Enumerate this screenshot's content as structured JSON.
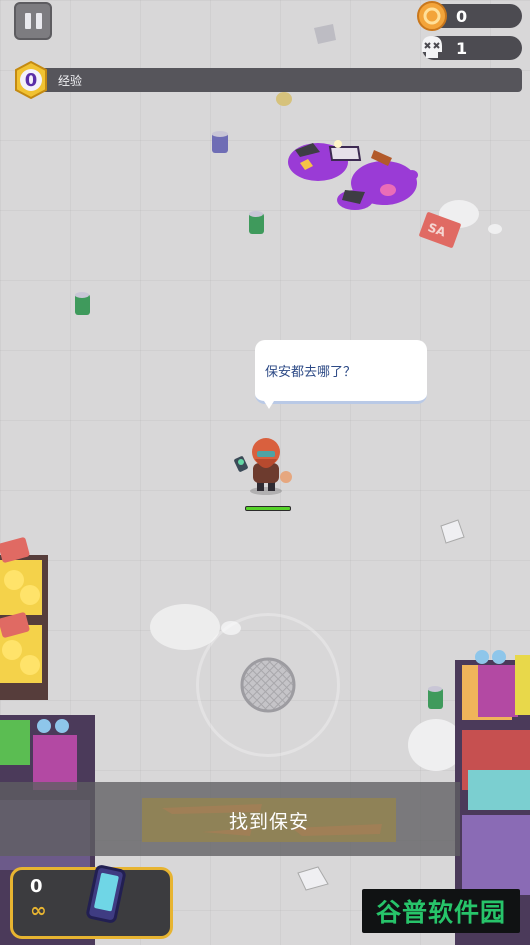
{
  "hud": {
    "pause_icon": "pause-icon",
    "coins": "0",
    "coin_icon": "coin-icon",
    "kills": "1",
    "skull_icon": "skull-icon",
    "level": "0",
    "xp_label": "经验",
    "xp_progress": 0.0,
    "colors": {
      "xp_fill": "#8a6dd8",
      "xp_track": "#56555b",
      "level_badge": "#f1c232",
      "coin": "#f3a43a"
    }
  },
  "dialogue": {
    "text": "保安都去哪了？"
  },
  "player": {
    "health_fraction": 1.0,
    "health_color": "#56d22a"
  },
  "objective": {
    "text": "找到保安"
  },
  "weapon": {
    "ammo": "0",
    "reserve": "∞",
    "icon": "phone-weapon-icon",
    "border_color": "#e7b431"
  },
  "watermark": {
    "text": "谷普软件园"
  }
}
